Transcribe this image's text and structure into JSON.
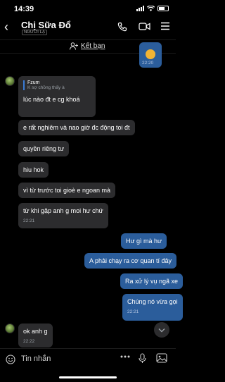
{
  "status_bar": {
    "time": "14:39"
  },
  "header": {
    "back_icon": "‹",
    "contact_name": "Chị Sữa Đổ",
    "badge": "NGƯỜI LẠ"
  },
  "add_friend": {
    "label": "Kết bạn"
  },
  "top_message": {
    "time": "22:20"
  },
  "messages": [
    {
      "text": "lúc nào đt e cg khoá",
      "quote_name": "Fzum",
      "quote_text": "K sợ chồng thấy à"
    },
    {
      "text": "e rất nghiêm và nao giờ đc động toi đt"
    },
    {
      "text": "quyền riêng tư"
    },
    {
      "text": "hiu hok"
    },
    {
      "text": "vì từ trước toi gioè e ngoan  mà"
    },
    {
      "text": "từ khi gặp anh g moi hư chứ",
      "time": "22:21"
    },
    {
      "text": "Hư gì mà hư"
    },
    {
      "text": "A phải chạy ra cơ quan tí đây"
    },
    {
      "text": "Ra xử lý vụ ngã xe"
    },
    {
      "text": "Chúng nó vừa gọi",
      "time": "22:21"
    },
    {
      "text": "ok anh g",
      "time": "22:22"
    }
  ],
  "composer": {
    "placeholder": "Tin nhắn"
  },
  "colors": {
    "background": "#000000",
    "incoming_bubble": "#2c2c2e",
    "outgoing_bubble": "#2b5d9b",
    "accent": "#3a7bd5"
  }
}
